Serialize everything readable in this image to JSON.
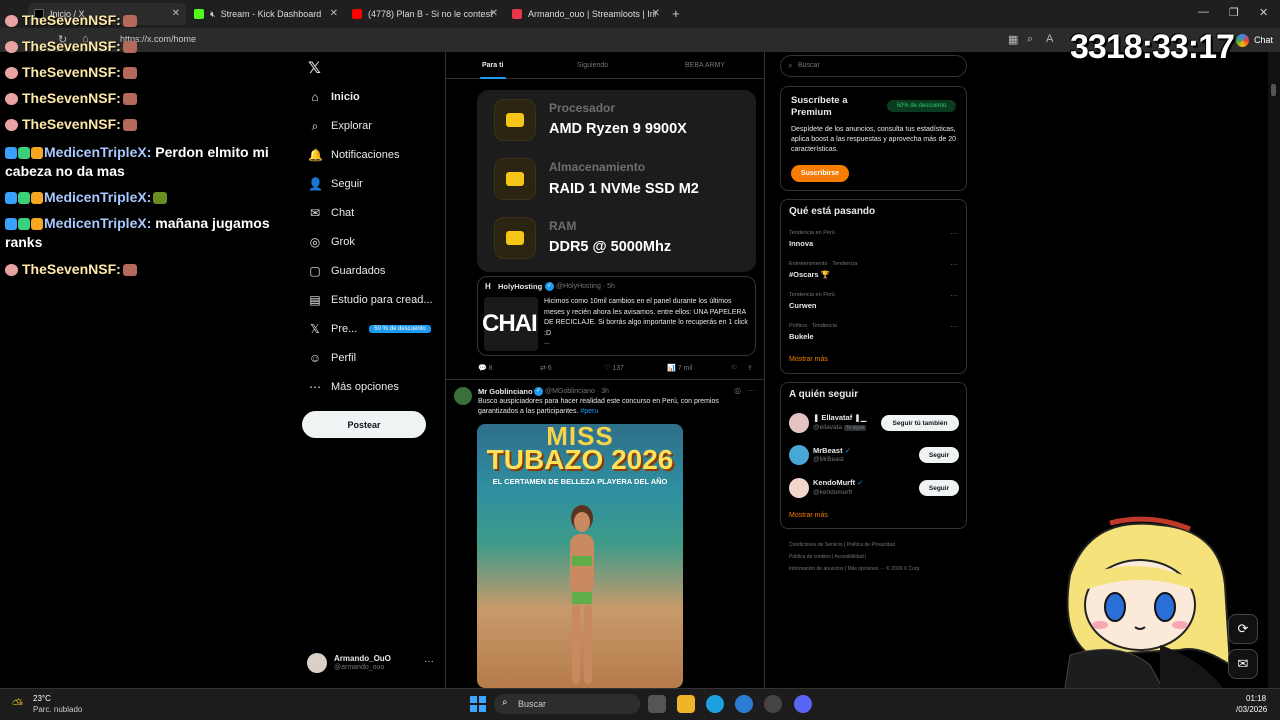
{
  "browser": {
    "tabs": [
      {
        "title": "Inicio / X",
        "fav_color": "#000000"
      },
      {
        "title": "Stream - Kick Dashboard",
        "fav_color": "#53fc18"
      },
      {
        "title": "(4778) Plan B - Si no le contesto fi",
        "fav_color": "#ff0000"
      },
      {
        "title": "Armando_ouo | Streamloots | Inte",
        "fav_color": "#e8374a"
      }
    ],
    "url": "https://x.com/home",
    "new_tab": "+",
    "minimize": "—",
    "maximize": "❐",
    "close": "✕"
  },
  "sidebar": {
    "logo": "𝕏",
    "items": [
      {
        "label": "Inicio",
        "icon": "⌂"
      },
      {
        "label": "Explorar",
        "icon": "⌕"
      },
      {
        "label": "Notificaciones",
        "icon": "🔔"
      },
      {
        "label": "Seguir",
        "icon": "👤"
      },
      {
        "label": "Chat",
        "icon": "✉"
      },
      {
        "label": "Grok",
        "icon": "◎"
      },
      {
        "label": "Guardados",
        "icon": "▢"
      },
      {
        "label": "Estudio para cread...",
        "icon": "▤"
      },
      {
        "label": "Pre...",
        "icon": "𝕏"
      },
      {
        "label": "Perfil",
        "icon": "☺"
      },
      {
        "label": "Más opciones",
        "icon": "⋯"
      }
    ],
    "premium_badge": "50 % de descuento",
    "post_button": "Postear",
    "account": {
      "name": "Armando_OuO",
      "handle": "@armando_ouo",
      "more": "···"
    }
  },
  "feed": {
    "tabs": [
      "Para ti",
      "Siguiendo",
      "BEBA ARMY"
    ],
    "specs": [
      {
        "label": "Procesador",
        "value": "AMD Ryzen 9 9900X"
      },
      {
        "label": "Almacenamiento",
        "value": "RAID 1 NVMe SSD M2"
      },
      {
        "label": "RAM",
        "value": "DDR5 @ 5000Mhz"
      }
    ],
    "quote": {
      "icon": "H",
      "name": "HolyHosting",
      "handle": "@HolyHosting · 5h",
      "thumb_text": "CHAI",
      "text": "Hicimos como 10mil cambios en el panel durante los últimos meses y recién ahora les avisamos. entre ellos: UNA PAPELERA DE RECICLAJE. Si borrás algo importante lo recuperás en 1 click :D",
      "ellipsis": "..."
    },
    "actions": {
      "reply": "💬 8",
      "retweet": "⇄ 6",
      "like": "♡ 137",
      "views": "📊 7 mil",
      "bookmark": "⚐",
      "share": "⇪"
    },
    "post2": {
      "name": "Mr Goblinciano",
      "handle": "@MGoblinciano · 3h",
      "text": "Busco auspiciadores para hacer realidad este concurso en Perú, con premios garantizados a las participantes.",
      "hashtag": "#peru",
      "grok": "◎",
      "more": "···",
      "poster_title1": "MISS",
      "poster_title2": "TUBAZO 2026",
      "poster_sub": "EL CERTAMEN DE BELLEZA PLAYERA DEL AÑO"
    }
  },
  "right": {
    "search_placeholder": "Buscar",
    "premium": {
      "title": "Suscríbete a Premium",
      "badge": "50% de descuento",
      "desc": "Despídete de los anuncios, consulta tus estadísticas, aplica boost a las respuestas y aprovecha más de 20 características.",
      "button": "Suscribirse"
    },
    "trends_title": "Qué está pasando",
    "trends": [
      {
        "ctx": "Tendencia en Perú",
        "name": "Innova"
      },
      {
        "ctx": "Entretenimiento · Tendencia",
        "name": "#Oscars 🏆"
      },
      {
        "ctx": "Tendencia en Perú",
        "name": "Curwen"
      },
      {
        "ctx": "Política · Tendencia",
        "name": "Bukele"
      }
    ],
    "trend_more": "···",
    "show_more": "Mostrar más",
    "follow_title": "A quién seguir",
    "follow": [
      {
        "name": "❚ Ellavataf ❚▁",
        "handle": "@ellavata",
        "tag": "Te sigue",
        "button": "Seguir tú también",
        "color": "#e6c3c3"
      },
      {
        "name": "MrBeast",
        "handle": "@MrBeast",
        "button": "Seguir",
        "color": "#49a7d6"
      },
      {
        "name": "KendoMurft",
        "handle": "@kendomurft",
        "button": "Seguir",
        "color": "#f2d6c9"
      }
    ],
    "footer": [
      "Condiciones de Servicio  |  Política de Privacidad",
      "Política de cookies  |  Accesibilidad  |",
      "Información de anuncios  |  Más opciones ···  © 2026 X Corp."
    ]
  },
  "stream": {
    "timer": "3318:33:17",
    "chat_button": "Chat",
    "chat": [
      {
        "user": "TheSevenNSF:",
        "msg": "",
        "style": "u1"
      },
      {
        "user": "TheSevenNSF:",
        "msg": "",
        "style": "u1"
      },
      {
        "user": "TheSevenNSF:",
        "msg": "",
        "style": "u1"
      },
      {
        "user": "TheSevenNSF:",
        "msg": "",
        "style": "u1"
      },
      {
        "user": "MedicenTripleX:",
        "msg": " Perdon elmito mi",
        "style": "u2"
      },
      {
        "user": "MedicenTripleX:",
        "msg": "",
        "style": "u2"
      },
      {
        "user": "MedicenTripleX:",
        "msg": " mañana jugamos",
        "style": "u2"
      },
      {
        "user": "TheSevenNSF:",
        "msg": "",
        "style": "u1"
      }
    ],
    "chat_wrap1": "cabeza no da mas",
    "chat_wrap2": "ranks"
  },
  "taskbar": {
    "temp": "23°C",
    "weather": "Parc. nublado",
    "search": "Buscar",
    "time": "01:18",
    "date": "/03/2026"
  }
}
